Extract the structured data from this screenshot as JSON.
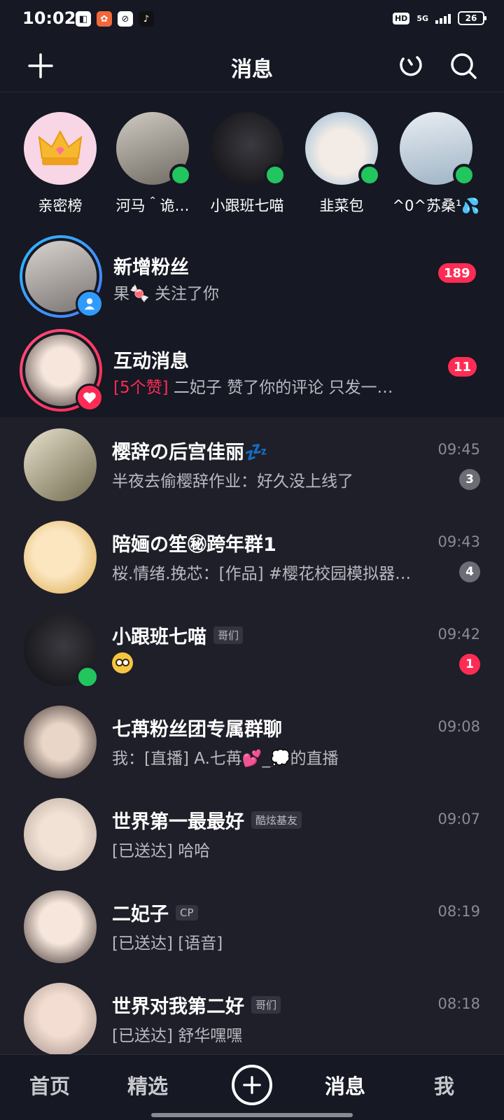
{
  "status_bar": {
    "time": "10:02",
    "network": "5G",
    "hd": "HD",
    "battery": "26"
  },
  "header": {
    "title": "消息"
  },
  "stories": [
    {
      "label": "亲密榜",
      "online": false
    },
    {
      "label": "河马＾诡…",
      "online": true
    },
    {
      "label": "小跟班七喵",
      "online": true
    },
    {
      "label": "韭菜包",
      "online": true
    },
    {
      "label": "^0^苏桑¹💦",
      "online": true
    }
  ],
  "system_rows": [
    {
      "title": "新增粉丝",
      "subtitle": "果🍬 关注了你",
      "badge": "189"
    },
    {
      "title": "互动消息",
      "subtitle_highlight": "[5个赞]",
      "subtitle": " 二妃子 赞了你的评论 只发一…",
      "badge": "11"
    }
  ],
  "conversations": [
    {
      "title": "樱辞の后宫佳丽💤",
      "tag": "",
      "preview": "半夜去偷樱辞作业：好久没上线了",
      "time": "09:45",
      "count": "3",
      "count_style": "grey",
      "online": false
    },
    {
      "title": "陪婳の笙㊙跨年群1",
      "tag": "",
      "preview": "桜.情绪.挽芯：[作品] #樱花校园模拟器…",
      "time": "09:43",
      "count": "4",
      "count_style": "grey",
      "online": false
    },
    {
      "title": "小跟班七喵",
      "tag": "哥们",
      "preview": "",
      "time": "09:42",
      "count": "1",
      "count_style": "red",
      "online": true
    },
    {
      "title": "七苒粉丝团专属群聊",
      "tag": "",
      "preview": "我：[直播] A.七苒💕_💭的直播",
      "time": "09:08",
      "count": "",
      "count_style": "",
      "online": false
    },
    {
      "title": "世界第一最最好",
      "tag": "酷炫基友",
      "preview": "[已送达] 哈哈",
      "time": "09:07",
      "count": "",
      "count_style": "",
      "online": false
    },
    {
      "title": "二妃子",
      "tag": "CP",
      "preview": "[已送达] [语音]",
      "time": "08:19",
      "count": "",
      "count_style": "",
      "online": false
    },
    {
      "title": "世界对我第二好",
      "tag": "哥们",
      "preview": "[已送达] 舒华嘿嘿",
      "time": "08:18",
      "count": "",
      "count_style": "",
      "online": false
    }
  ],
  "tabbar": {
    "home": "首页",
    "featured": "精选",
    "messages": "消息",
    "me": "我"
  },
  "colors": {
    "background": "#161823",
    "accent": "#fe2c55",
    "online": "#22c55e"
  }
}
